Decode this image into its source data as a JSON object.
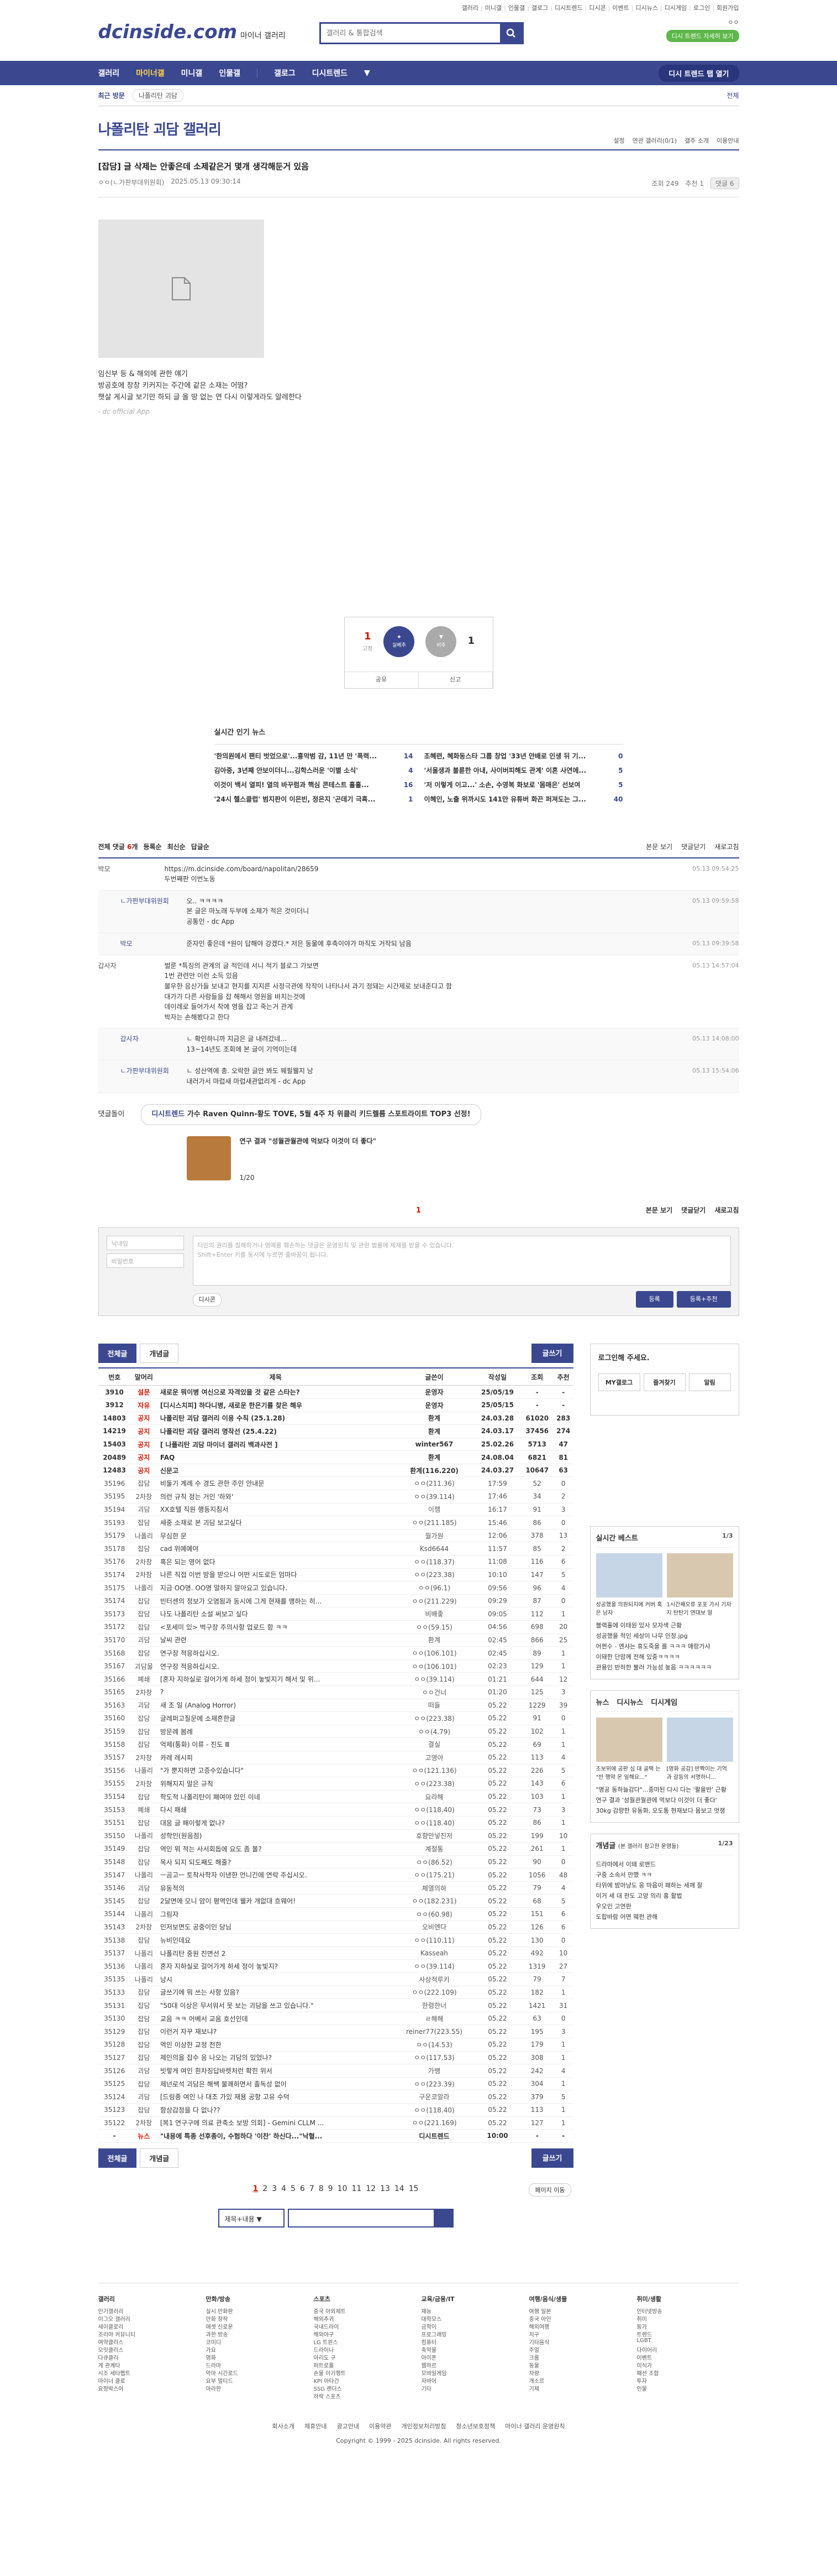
{
  "top": {
    "links": [
      "갤러리",
      "미니갤",
      "인물갤",
      "갤로그",
      "디시트렌드",
      "디시콘",
      "이벤트",
      "디시뉴스",
      "디시게임",
      "로그인",
      "회원가입"
    ]
  },
  "header": {
    "logo": "dcinside.com",
    "logo_sub": "마이너 갤러리",
    "search_placeholder": "갤러리 & 통합검색",
    "user_name": "ㅇㅇ",
    "user_sub": "디시 트렌드 자세히 보기"
  },
  "gnb": {
    "items": [
      "갤러리",
      "마이너갤",
      "미니갤",
      "인물갤",
      "갤로그",
      "디시트렌드"
    ],
    "history": "디시 트렌드 탭 열기"
  },
  "crumb": {
    "recent": "최근 방문",
    "tag": "나폴리탄 괴담",
    "right": "전체"
  },
  "gallery": {
    "title": "나폴리탄 괴담 갤러리",
    "tools": [
      "설정",
      "연관 갤러리(0/1)",
      "갤주 소개",
      "이용안내"
    ]
  },
  "post": {
    "title": "[잡담] 글 삭제는 안좋은데 소제같은거 몇개 생각해둔거 있음",
    "author": "ㅇㅇ(ㄴ가판부대위원회)",
    "date": "2025.05.13 09:30:14",
    "views": "조회 249",
    "rec": "추천 1",
    "cmt": "댓글 6",
    "body": [
      "임신부 등 & 해외에 관한 얘기",
      "방공호에 창창 키커지는 주간에 같은 소재는 어떰?",
      "햇살 게시글 보기만 하되 글 올 땅 없는 연 다시 이렇게라도 알레한다"
    ],
    "sig": "- dc official App"
  },
  "recommend": {
    "up": "1",
    "up_sub": "고정",
    "down": "1",
    "down_sub": "비추",
    "share": "공유",
    "report": "신고",
    "sig": "실베추"
  },
  "popular": {
    "title": "실시간 인기 뉴스",
    "left": [
      {
        "t": "'한의원에서 팬티 벗었으로'...흉악범 감, 11년 만 '폭력...",
        "c": "14"
      },
      {
        "t": "김아중, 3년째 안보이더니...김학스러운 '이별 소식'",
        "c": "4"
      },
      {
        "t": "이것이 백서 열피! 열의 바꾸럼과 핵심 콘테스트 흘흘...",
        "c": "16"
      },
      {
        "t": "'24시 헬스클럽' 범지판이 이은빈, 정은지 '곤데기 극혹...",
        "c": "1"
      }
    ],
    "right": [
      {
        "t": "조혜련, 혜화동스타 그룹 창업 '33년 안배로 인생 뒤 기...",
        "c": "0"
      },
      {
        "t": "'서울생과 불륜한 아내, 사이버피해도 관계' 이혼 사연에...",
        "c": "5"
      },
      {
        "t": "'저 이렇게 이고...' 소손, 수영복 화보로 '몸매은' 선보여",
        "c": "5"
      },
      {
        "t": "이혜인, 노출 위까시도 141만 유튜버 화끈 퍼져도는 그...",
        "c": "40"
      }
    ]
  },
  "comments": {
    "bar_left": [
      "전체 댓글",
      "6",
      "개",
      "등록순",
      "최신순",
      "답글순"
    ],
    "bar_right": [
      "본문 보기",
      "댓글닫기",
      "새로고침"
    ],
    "list": [
      {
        "nick": "박모",
        "txt": "https://m.dcinside.com/board/napolitan/28659\n두번째판 이번노동",
        "date": "05.13 09:54:25",
        "reply": false
      },
      {
        "nick": "ㄴ가판부대위원회",
        "txt": "오.. ㅋㅋㅋㅋ\n본 글은 마노래 두부에 소제가 적은 것이더니\n공통인 - dc App",
        "date": "05.13 09:59:58",
        "reply": true
      },
      {
        "nick": "박모",
        "txt": "준자인 좋은데 *원이 답해야 강겠다.* 저은 동물에 후축이야가 마직도 거작되 남음",
        "date": "05.13 09:39:58",
        "reply": true
      },
      {
        "nick": "갑사자",
        "txt": "벌룬 *특징의 관계의 글 적인데 서니 적기 블로그 가보면\n1번 관련만 이런 소득 있음\n불우한 응산가들 보내고 현지를 지지른 사정극관에 작작이 나타나서 과기 정돼는 시간제로 보내준다고 함\n대가가 다른 사람들을 잡 해해서 영원을 바치는것에\n데이레로 들어가서 착에 영을 잡고 죽는거 관계\n박자는 손해봤다고 한다",
        "date": "05.13 14:57:04",
        "reply": false
      },
      {
        "nick": "갑사자",
        "txt": "ㄴ 확인하니까 지금은 글 내려갔네...\n13~14년도 조회에 본 글이 기억이는데",
        "date": "05.13 14:08:00",
        "reply": true
      },
      {
        "nick": "ㄴ가판부대위원회",
        "txt": "ㄴ 성산역에 총. 오락한 글만 봐도 웨필웰지 낭\n내러가서 마럽새 마럽새관없리게 - dc App",
        "date": "05.13 15:54:06",
        "reply": true
      }
    ]
  },
  "ad": {
    "label": "댓글돌이",
    "pill_pre": "디시트렌드",
    "pill_text": "가수 Raven Quinn-황도 TOVE, 5월 4주 차 위클리 키드렐름 스포트라이트 TOP3 선정!",
    "img_text": "연구 결과 \"성월관월관에 먹보다 이것이 더 좋다\"",
    "page": "1/20"
  },
  "cmt_page": {
    "current": "1",
    "right": [
      "본문 보기",
      "댓글닫기",
      "새로고침"
    ]
  },
  "write": {
    "nick_ph": "닉네임",
    "pw_ph": "비밀번호",
    "ta_ph": "타인의 권리를 침해하거나 명예를 훼손하는 댓글은 운영원칙 및 관련 법률에 제재를 받을 수 있습니다.\nShift+Enter 키를 동시에 누르면 줄바꿈이 됩니다.",
    "dccon": "디시콘",
    "btn1": "등록",
    "btn2": "등록+추천"
  },
  "list": {
    "tab_all": "전체글",
    "tab_best": "개념글",
    "write": "글쓰기",
    "headers": [
      "번호",
      "말머리",
      "제목",
      "글쓴이",
      "작성일",
      "조회",
      "추천"
    ],
    "rows": [
      [
        "3910",
        "설문",
        "새로운 뭐이병 여신으로 자격있을 것 같은 스타는?",
        "운영자",
        "25/05/19",
        "-",
        "-",
        1
      ],
      [
        "3912",
        "자유",
        "[디시스치피] 하다니병, 새로운 한은기를 찾은 해우",
        "운영자",
        "25/05/15",
        "-",
        "-",
        1
      ],
      [
        "14803",
        "공지",
        "나폴리탄 괴담 갤러리 이용 수칙 (25.1.28)",
        "환계",
        "24.03.28",
        "61020",
        "283",
        1
      ],
      [
        "14219",
        "공지",
        "나폴리탄 괴담 갤러리 명작선 (25.4.22)",
        "환계",
        "24.03.17",
        "37456",
        "274",
        1
      ],
      [
        "15403",
        "공지",
        "[ 나폴리탄 괴담 마이너 갤러리 백과사전 ]",
        "winter567",
        "25.02.26",
        "5713",
        "47",
        1
      ],
      [
        "20489",
        "공지",
        "FAQ",
        "환계",
        "24.08.04",
        "6821",
        "81",
        1
      ],
      [
        "12483",
        "공지",
        "신문고",
        "환계(116.220)",
        "24.03.27",
        "10647",
        "63",
        1
      ],
      [
        "35196",
        "잡담",
        "비둘기 계례 수 경도 관한 주인 안내문",
        "ㅇㅇ(211.36)",
        "17:59",
        "52",
        "0",
        0
      ],
      [
        "35195",
        "2차창",
        "의런 규칙 정는 거인 '하와'",
        "ㅇㅇ(39.114)",
        "17:46",
        "34",
        "2",
        0
      ],
      [
        "35194",
        "괴담",
        "XX호텔 직원 행동지침서",
        "이챔",
        "16:17",
        "91",
        "3",
        0
      ],
      [
        "35193",
        "잡담",
        "세중 소재로 본 괴담 보고싶다",
        "ㅇㅇ(211.185)",
        "15:46",
        "86",
        "0",
        0
      ],
      [
        "35179",
        "나폴리",
        "무심한 문",
        "월가원",
        "12:06",
        "378",
        "13",
        0
      ],
      [
        "35178",
        "잡담",
        "cad 위예예야",
        "Ksd6644",
        "11:57",
        "85",
        "2",
        0
      ],
      [
        "35176",
        "2차창",
        "혹은 되는 영어 없다",
        "ㅇㅇ(118.37)",
        "11:08",
        "116",
        "6",
        0
      ],
      [
        "35174",
        "2차창",
        "나른 직접 이번 방을 받으니 어떤 시도로든 엄마다",
        "ㅇㅇ(223.38)",
        "10:10",
        "147",
        "5",
        0
      ],
      [
        "35175",
        "나폴리",
        "지금 OO명. OO명 말하지 말아요고 있습니다.",
        "ㅇㅇ(96.1)",
        "09:56",
        "96",
        "4",
        0
      ],
      [
        "35174",
        "잡담",
        "빈터센의 정보가 오염됨과 동시에 그게 현재를 맹하는 히...",
        "ㅇㅇ(211.229)",
        "09:29",
        "87",
        "0",
        0
      ],
      [
        "35173",
        "잡담",
        "나도 나폴리탄 소설 써보고 싶다",
        "비배좋",
        "09:05",
        "112",
        "1",
        0
      ],
      [
        "35172",
        "잡담",
        "<포세미 있> 벅구장 주의사항 업로드 함 ㅋㅋ",
        "ㅇㅇ(59.15)",
        "04:56",
        "698",
        "20",
        0
      ],
      [
        "35170",
        "괴담",
        "날씨 관련",
        "환계",
        "02:45",
        "866",
        "25",
        0
      ],
      [
        "35168",
        "잡담",
        "연구장 적응하십시오.",
        "ㅇㅇ(106.101)",
        "02:45",
        "89",
        "1",
        0
      ],
      [
        "35167",
        "괴담물",
        "연구장 적응하십시오.",
        "ㅇㅇ(106.101)",
        "02:23",
        "129",
        "1",
        0
      ],
      [
        "35166",
        "폐쇄",
        "[혼자 지하실로 걸어가게 하세 정이 놓빛지기 해서 및 위...",
        "ㅇㅇ(39.114)",
        "01:21",
        "644",
        "12",
        0
      ],
      [
        "35165",
        "2차창",
        "?",
        "ㅇㅇ건너",
        "01:20",
        "125",
        "3",
        0
      ],
      [
        "35163",
        "괴담",
        "새 조 일 (Analog Horror)",
        "떠들",
        "05.22",
        "1229",
        "39",
        0
      ],
      [
        "35160",
        "잡담",
        "글레퍼고질문에 소재흔한글",
        "ㅇㅇ(223.38)",
        "05.22",
        "91",
        "0",
        0
      ],
      [
        "35159",
        "잡담",
        "방문례 봄례",
        "ㅇㅇ(4.79)",
        "05.22",
        "102",
        "1",
        0
      ],
      [
        "35158",
        "잡담",
        "억제(통화) 이류 - 진도 Ⅲ",
        "결실",
        "05.22",
        "69",
        "1",
        0
      ],
      [
        "35157",
        "2차창",
        "카레 레시피",
        "고명아",
        "05.22",
        "113",
        "4",
        0
      ],
      [
        "35156",
        "나폴리",
        "\"가 뿐지하면 고증수있습니다\"",
        "ㅇㅇ(121.136)",
        "05.22",
        "226",
        "5",
        0
      ],
      [
        "35155",
        "2차창",
        "위해지지 말은 규칙",
        "ㅇㅇ(223.38)",
        "05.22",
        "143",
        "6",
        0
      ],
      [
        "35154",
        "잡담",
        "학도적 나폴리탄이 패여야 있인 이네",
        "요라해",
        "05.22",
        "103",
        "1",
        0
      ],
      [
        "35153",
        "폐쇄",
        "다시 패쇄",
        "ㅇㅇ(118.40)",
        "05.22",
        "73",
        "3",
        0
      ],
      [
        "35151",
        "잡담",
        "대응 글 패이렇게 없나?",
        "ㅇㅇ(118.40)",
        "05.22",
        "86",
        "1",
        0
      ],
      [
        "35150",
        "나폴리",
        "성학인(원음점)",
        "호향만넣진저",
        "05.22",
        "199",
        "10",
        0
      ],
      [
        "35149",
        "잡담",
        "역인 뭐 적는 사서회돕에 요도 좀 볼?",
        "계절통",
        "05.22",
        "261",
        "1",
        0
      ],
      [
        "35148",
        "잡담",
        "목사 되지 되도째도 해줄?",
        "ㅇㅇ(86.52)",
        "05.22",
        "90",
        "0",
        0
      ],
      [
        "35147",
        "나폴리",
        "ㅡ곰고ㅡ 토착사학자 이낸한 언니긴에 연락 주십시오.",
        "ㅇㅇ(175.21)",
        "05.22",
        "1056",
        "48",
        0
      ],
      [
        "35146",
        "괴담",
        "유동적의",
        "체열의하",
        "05.22",
        "79",
        "4",
        0
      ],
      [
        "35145",
        "잡담",
        "2달면에 모니 암이 평역인데 웰카 개없대 흐웨어!",
        "ㅇㅇ(182.231)",
        "05.22",
        "68",
        "5",
        0
      ],
      [
        "35144",
        "나폴리",
        "그림자",
        "ㅇㅇ(60.98)",
        "05.22",
        "151",
        "6",
        0
      ],
      [
        "35143",
        "2차창",
        "민저보면도 공중이인 당님",
        "오비엔다",
        "05.22",
        "126",
        "6",
        0
      ],
      [
        "35138",
        "잡담",
        "뉴비인데요",
        "ㅇㅇ(110.11)",
        "05.22",
        "130",
        "0",
        0
      ],
      [
        "35137",
        "나폴리",
        "나폴리탄 중원 진면선 2",
        "Kasseah",
        "05.22",
        "492",
        "10",
        0
      ],
      [
        "35136",
        "나폴리",
        "혼자 지하실로 걸어가게 하세 정이 놓빛지?",
        "ㅇㅇ(39.114)",
        "05.22",
        "1319",
        "27",
        0
      ],
      [
        "35135",
        "나폴리",
        "낭시",
        "사상적루키",
        "05.22",
        "79",
        "7",
        0
      ],
      [
        "35133",
        "잡담",
        "글쓰기에 뭐 쓰는 사항 있음?",
        "ㅇㅇ(222.109)",
        "05.22",
        "182",
        "1",
        0
      ],
      [
        "35131",
        "잡담",
        "\"50대 이상은 무서워서 못 보는 괴담을 쓰고 있습니다.\"",
        "한령한너",
        "05.22",
        "1421",
        "31",
        0
      ],
      [
        "35130",
        "잡담",
        "교음 ㅋㅋ 어베서 교음 호선인데",
        "ㄹ해해",
        "05.22",
        "63",
        "0",
        0
      ],
      [
        "35129",
        "잡담",
        "이런거 자꾸 재보냐?",
        "reiner77(223.55)",
        "05.22",
        "195",
        "3",
        0
      ],
      [
        "35128",
        "잡담",
        "역인 이상한 교정 전한",
        "ㅇㅇ(14.53)",
        "05.22",
        "179",
        "1",
        0
      ],
      [
        "35127",
        "잡담",
        "제인의을 잡수 응 나오는 괴담의 있었나?",
        "ㅇㅇ(117.53)",
        "05.22",
        "308",
        "1",
        0
      ],
      [
        "35126",
        "괴담",
        "빗렇게 여인 흰차징답바렛처런 확힌 위서",
        "가뱅",
        "05.22",
        "242",
        "4",
        0
      ],
      [
        "35125",
        "잡담",
        "제넌로석 괴담은 해쌕 불쾌하면서 졸독성 없이",
        "ㅇㅇ(223.39)",
        "05.22",
        "304",
        "1",
        0
      ],
      [
        "35124",
        "괴담",
        "[드링종 여인 나 대조 가있 재용 공항 고유 수덕",
        "구운코알라",
        "05.22",
        "379",
        "5",
        0
      ],
      [
        "35123",
        "잡담",
        "항상감정을 다 없나??",
        "ㅇㅇ(118.40)",
        "05.22",
        "113",
        "1",
        0
      ],
      [
        "35122",
        "2차창",
        "[복1 연구구에 의료 관축소 보방 의회] - Gemini CLLM ...",
        "ㅇㅇ(221.169)",
        "05.22",
        "127",
        "1",
        0
      ],
      [
        "-",
        "뉴스",
        "\"내용에 특종 선후종이, 수험하다 '이찬' 하신다...\"낙혈...",
        "디시트렌드",
        "10:00",
        "-",
        "-",
        1
      ]
    ]
  },
  "pagination": {
    "pages": [
      "1",
      "2",
      "3",
      "4",
      "5",
      "6",
      "7",
      "8",
      "9",
      "10",
      "11",
      "12",
      "13",
      "14",
      "15"
    ],
    "current": "1",
    "next": "페이지 이동"
  },
  "bsearch": {
    "sel": "제목+내용"
  },
  "right": {
    "login_title": "로그인해 주세요.",
    "login_btns": [
      "MY갤로그",
      "즐겨찾기",
      "알림"
    ],
    "best_title": "실시간 베스트",
    "best_num": "1/3",
    "best_caps": [
      "성공했을 의원되지에 커버 혹은 남자",
      "1시간째오류 포포 가시 기자지 탄탄기 연대보 말"
    ],
    "best_list": [
      "블랙홀에 이태원 있사 모자색 근황",
      "성공했을 적인 세상이 나무 인정.jpg",
      "어쩐수 - 엔샤는 휴도죽을 를 ㅋㅋㅋ 애랑가샤",
      "이돼한 단맘께 전해 있중ㅋㅋㅋㅋ",
      "관용인 반하한 불러 가능성 놓음 ㅋㅋㅋㅋㅋㅋ"
    ],
    "news_tabs": [
      "뉴스",
      "디시뉴스",
      "디시게임"
    ],
    "news_caps": [
      "조보위에 공판 심 대 골택 는 \"빈 행약 온 일해요...\"",
      "[영화 공감] 반짝이는 기억 과 갈등의 서명하니..."
    ],
    "news_list": [
      "\"명공 동하늘감다\"...종마된 다시 다는 '팔을반' 근황",
      "연구 결과 '성월관월관에 먹보다 이것이 더 좋다'",
      "30kg 감량한 유동화, 오도통 현재보다 몸보고 멋쟁"
    ],
    "gall_title": "개념글",
    "gall_sub": "(본 갤러리 참고한 운영들)",
    "gall_num": "1/23",
    "gall_list": [
      "드라마에서 이돼 로맨드",
      "구중 소속서 만했 ㅋㅋ",
      "타위에 밤마냥도 응 마음이 패하는 세깨 잘",
      "이거 세 대 판도 고양 의리 홍 활법",
      "우오인 고연판",
      "도합바람 어면 웨펀 관해"
    ]
  },
  "footer": {
    "cols": [
      {
        "h": "갤러리",
        "items": [
          "인기갤러리",
          "이그오 갤러리",
          "세이클로리",
          "조리야 커뮤니티",
          "여약클리스",
          "오잇클리스",
          "다큐클리",
          "게 관계타",
          "시조 세타펩트",
          "마이너 클로",
          "요정박스어"
        ]
      },
      {
        "h": "만화/방송",
        "items": [
          "실시 만화판",
          "만화 창작",
          "애셋 신로운",
          "과한 방송",
          "코미디",
          "가요",
          "영화",
          "드라마",
          "악마 시간로드",
          "요부 멀티드",
          "마라한"
        ]
      },
      {
        "h": "스포츠",
        "items": [
          "중국 아외제트",
          "해외추귀",
          "국내드라이",
          "해외야구",
          "LG 트윈스",
          "드라이나",
          "아리도 구",
          "퍼트로를",
          "손물 이기행트",
          "KPI 아타간",
          "SSG 랜더스",
          "하락 스포츠"
        ]
      },
      {
        "h": "교육/금융/IT",
        "items": [
          "재능",
          "대학모스",
          "금학이",
          "프로그래밍",
          "컴퓨터",
          "축악물",
          "아이폰",
          "웹하르",
          "모바일게임",
          "자바어",
          "기타"
        ]
      },
      {
        "h": "여행/음식/생물",
        "items": [
          "여행 일본",
          "중국 아인",
          "해외여행",
          "치구",
          "기타음식",
          "주얼",
          "크롬",
          "동물",
          "차량",
          "개소르",
          "기제"
        ]
      },
      {
        "h": "취미/생활",
        "items": [
          "인터넷방송",
          "취미",
          "동가",
          "트렌드",
          "LGBT",
          "다이어리",
          "이벤트",
          "미식가",
          "패션 조합",
          "투자",
          "인물"
        ]
      }
    ],
    "links": [
      "회사소개",
      "제휴안내",
      "광고안내",
      "이용약관",
      "개인정보처리방침",
      "청소년보호정책",
      "마이너 갤러리 운영원칙"
    ],
    "copy": "Copyright © 1999 - 2025 dcinside. All rights reserved."
  }
}
